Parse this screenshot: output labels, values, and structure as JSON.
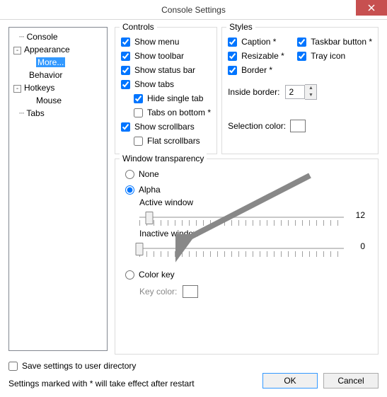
{
  "window": {
    "title": "Console Settings"
  },
  "tree": {
    "console": "Console",
    "appearance": "Appearance",
    "more": "More...",
    "behavior": "Behavior",
    "hotkeys": "Hotkeys",
    "mouse": "Mouse",
    "tabs": "Tabs"
  },
  "controls": {
    "title": "Controls",
    "show_menu": "Show menu",
    "show_toolbar": "Show toolbar",
    "show_statusbar": "Show status bar",
    "show_tabs": "Show tabs",
    "hide_single_tab": "Hide single tab",
    "tabs_on_bottom": "Tabs on bottom *",
    "show_scrollbars": "Show scrollbars",
    "flat_scrollbars": "Flat scrollbars",
    "checks": {
      "show_menu": true,
      "show_toolbar": true,
      "show_statusbar": true,
      "show_tabs": true,
      "hide_single_tab": true,
      "tabs_on_bottom": false,
      "show_scrollbars": true,
      "flat_scrollbars": false
    }
  },
  "styles": {
    "title": "Styles",
    "caption": "Caption *",
    "resizable": "Resizable *",
    "border": "Border *",
    "taskbar": "Taskbar button *",
    "tray": "Tray icon",
    "inside_border": "Inside border:",
    "inside_border_val": "2",
    "selection_color": "Selection color:",
    "checks": {
      "caption": true,
      "resizable": true,
      "border": true,
      "taskbar": true,
      "tray": true
    },
    "selection_hex": "#000000"
  },
  "trans": {
    "title": "Window transparency",
    "none": "None",
    "alpha": "Alpha",
    "active": "Active window",
    "inactive": "Inactive window",
    "color_key": "Color key",
    "key_color": "Key color:",
    "active_val": "12",
    "inactive_val": "0",
    "selected": "alpha",
    "active_pos_pct": 5,
    "inactive_pos_pct": 0,
    "key_hex": "#000000"
  },
  "footer": {
    "save_dir": "Save settings to user directory",
    "note": "Settings marked with * will take effect after restart",
    "ok": "OK",
    "cancel": "Cancel"
  }
}
